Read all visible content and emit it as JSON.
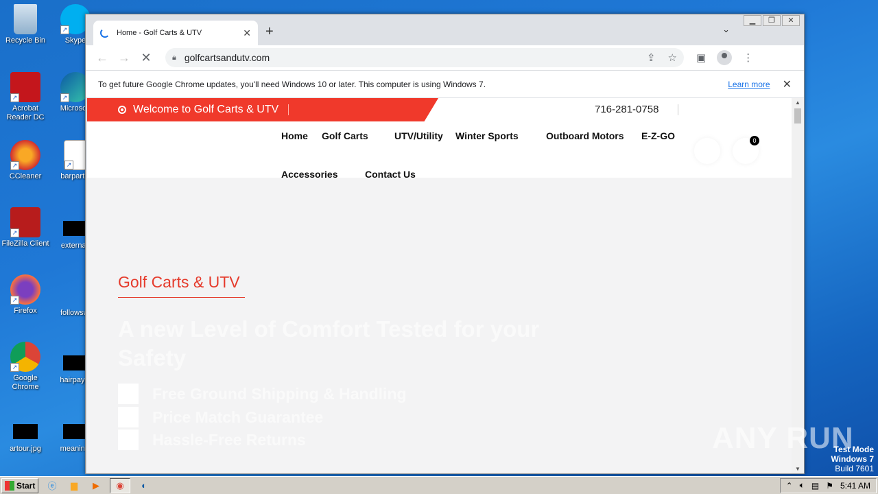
{
  "desktop": {
    "icons_left": [
      {
        "label": "Recycle Bin"
      },
      {
        "label": "Acrobat Reader DC"
      },
      {
        "label": "CCleaner"
      },
      {
        "label": "FileZilla Client"
      },
      {
        "label": "Firefox"
      },
      {
        "label": "Google Chrome"
      },
      {
        "label": "artour.jpg"
      }
    ],
    "icons_right": [
      {
        "label": "Skype"
      },
      {
        "label": "Microsoft"
      },
      {
        "label": "barpartie"
      },
      {
        "label": "externalt"
      },
      {
        "label": "followswi"
      },
      {
        "label": "hairpaym"
      },
      {
        "label": "meanindi"
      }
    ],
    "watermark": "ANY RUN",
    "test_mode": {
      "line1": "Test Mode",
      "line2": "Windows 7",
      "line3": "Build 7601"
    }
  },
  "browser": {
    "tab_title": "Home - Golf Carts & UTV",
    "url": "golfcartsandutv.com",
    "infobar": {
      "message": "To get future Google Chrome updates, you'll need Windows 10 or later. This computer is using Windows 7.",
      "learn_more": "Learn more"
    }
  },
  "site": {
    "welcome": "Welcome to Golf Carts & UTV",
    "phone": "716-281-0758",
    "nav": {
      "home": "Home",
      "golf_carts": "Golf Carts",
      "utv": "UTV/Utility",
      "winter": "Winter Sports",
      "outboard": "Outboard Motors",
      "ezgo": "E-Z-GO",
      "accessories": "Accessories",
      "contact": "Contact Us"
    },
    "cart_count": "0",
    "hero": {
      "brand": "Golf Carts & UTV",
      "headline": "A new Level of Comfort Tested for your Safety",
      "features": [
        "Free Ground Shipping & Handling",
        "Price Match Guarantee",
        "Hassle-Free Returns"
      ]
    }
  },
  "taskbar": {
    "start": "Start",
    "time": "5:41 AM"
  }
}
